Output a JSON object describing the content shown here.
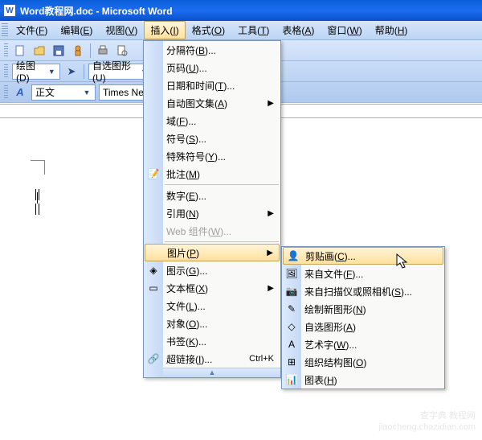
{
  "title": "Word教程网.doc - Microsoft Word",
  "menubar": [
    "文件(F)",
    "编辑(E)",
    "视图(V)",
    "插入(I)",
    "格式(O)",
    "工具(T)",
    "表格(A)",
    "窗口(W)",
    "帮助(H)"
  ],
  "open_menu_index": 3,
  "toolbar_row3": {
    "label_draw": "绘图(D)",
    "label_autoshape": "自选图形(U)"
  },
  "toolbar_row4": {
    "style_label": "正文",
    "font_label": "Times New R"
  },
  "insert_menu": [
    {
      "label": "分隔符(B)..."
    },
    {
      "label": "页码(U)..."
    },
    {
      "label": "日期和时间(T)..."
    },
    {
      "label": "自动图文集(A)",
      "submenu": true
    },
    {
      "label": "域(F)..."
    },
    {
      "label": "符号(S)..."
    },
    {
      "label": "特殊符号(Y)..."
    },
    {
      "label": "批注(M)",
      "icon": "comment"
    },
    {
      "sep": true
    },
    {
      "label": "数字(E)..."
    },
    {
      "label": "引用(N)",
      "submenu": true
    },
    {
      "label": "Web 组件(W)...",
      "disabled": true
    },
    {
      "sep": true
    },
    {
      "label": "图片(P)",
      "submenu": true,
      "highlight": true
    },
    {
      "label": "图示(G)...",
      "icon": "diagram"
    },
    {
      "label": "文本框(X)",
      "submenu": true,
      "icon": "textbox"
    },
    {
      "label": "文件(L)..."
    },
    {
      "label": "对象(O)..."
    },
    {
      "label": "书签(K)..."
    },
    {
      "label": "超链接(I)...",
      "shortcut": "Ctrl+K",
      "icon": "link"
    }
  ],
  "picture_submenu": [
    {
      "label": "剪贴画(C)...",
      "icon": "clipart",
      "highlight": true
    },
    {
      "label": "来自文件(F)...",
      "icon": "file"
    },
    {
      "label": "来自扫描仪或照相机(S)...",
      "icon": "scanner"
    },
    {
      "label": "绘制新图形(N)",
      "icon": "draw"
    },
    {
      "label": "自选图形(A)",
      "icon": "shapes"
    },
    {
      "label": "艺术字(W)...",
      "icon": "wordart"
    },
    {
      "label": "组织结构图(O)",
      "icon": "orgchart"
    },
    {
      "label": "图表(H)",
      "icon": "chart"
    }
  ],
  "watermark": "查字典 教程网\njiaocheng.chazidian.com"
}
